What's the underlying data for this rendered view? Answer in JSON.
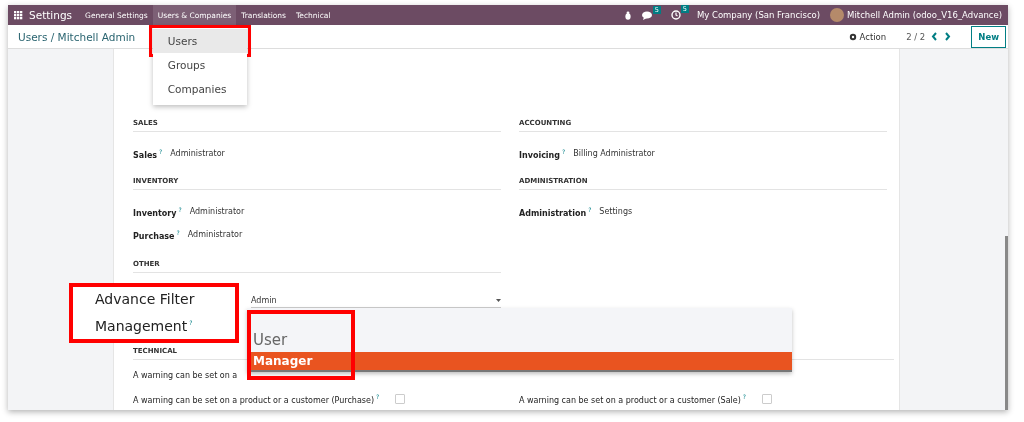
{
  "navbar": {
    "app_name": "Settings",
    "menus": [
      {
        "label": "General Settings",
        "selected": false
      },
      {
        "label": "Users & Companies",
        "selected": true
      },
      {
        "label": "Translations",
        "selected": false
      },
      {
        "label": "Technical",
        "selected": false
      }
    ],
    "messages_badge": "5",
    "activities_badge": "5",
    "company": "My Company (San Francisco)",
    "user": "Mitchell Admin (odoo_V16_Advance)"
  },
  "menu_dropdown": {
    "items": [
      {
        "label": "Users",
        "selected": true,
        "highlighted": true
      },
      {
        "label": "Groups",
        "selected": false,
        "highlighted": false
      },
      {
        "label": "Companies",
        "selected": false,
        "highlighted": false
      }
    ]
  },
  "control_panel": {
    "breadcrumb": "Users / Mitchell Admin",
    "action": "Action",
    "pager": "2 / 2",
    "new_button": "New"
  },
  "form": {
    "sections": [
      {
        "title": "SALES",
        "fields": [
          {
            "label": "Sales",
            "help": "?",
            "value": "Administrator"
          }
        ]
      },
      {
        "title": "ACCOUNTING",
        "fields": [
          {
            "label": "Invoicing",
            "help": "?",
            "value": "Billing Administrator"
          }
        ]
      },
      {
        "title": "INVENTORY",
        "fields": [
          {
            "label": "Inventory",
            "help": "?",
            "value": "Administrator"
          },
          {
            "label": "Purchase",
            "help": "?",
            "value": "Administrator"
          }
        ]
      },
      {
        "title": "ADMINISTRATION",
        "fields": [
          {
            "label": "Administration",
            "help": "?",
            "value": "Settings"
          }
        ]
      }
    ],
    "other": {
      "title": "OTHER",
      "field": {
        "label": "Advance Filter Management",
        "help": "?",
        "highlighted": true,
        "value": "Admin",
        "options_highlighted": true,
        "options": [
          {
            "label": "User",
            "selected": false
          },
          {
            "label": "Manager",
            "selected": true
          }
        ]
      }
    },
    "technical": {
      "title": "TECHNICAL",
      "rows": [
        [
          {
            "label": "A warning can be set on a"
          }
        ],
        [
          {
            "label": "A warning can be set on a product or a customer (Purchase)",
            "help": "?",
            "checked": false
          },
          {
            "label": "A warning can be set on a product or a customer (Sale)",
            "help": "?",
            "checked": false
          }
        ]
      ]
    }
  }
}
